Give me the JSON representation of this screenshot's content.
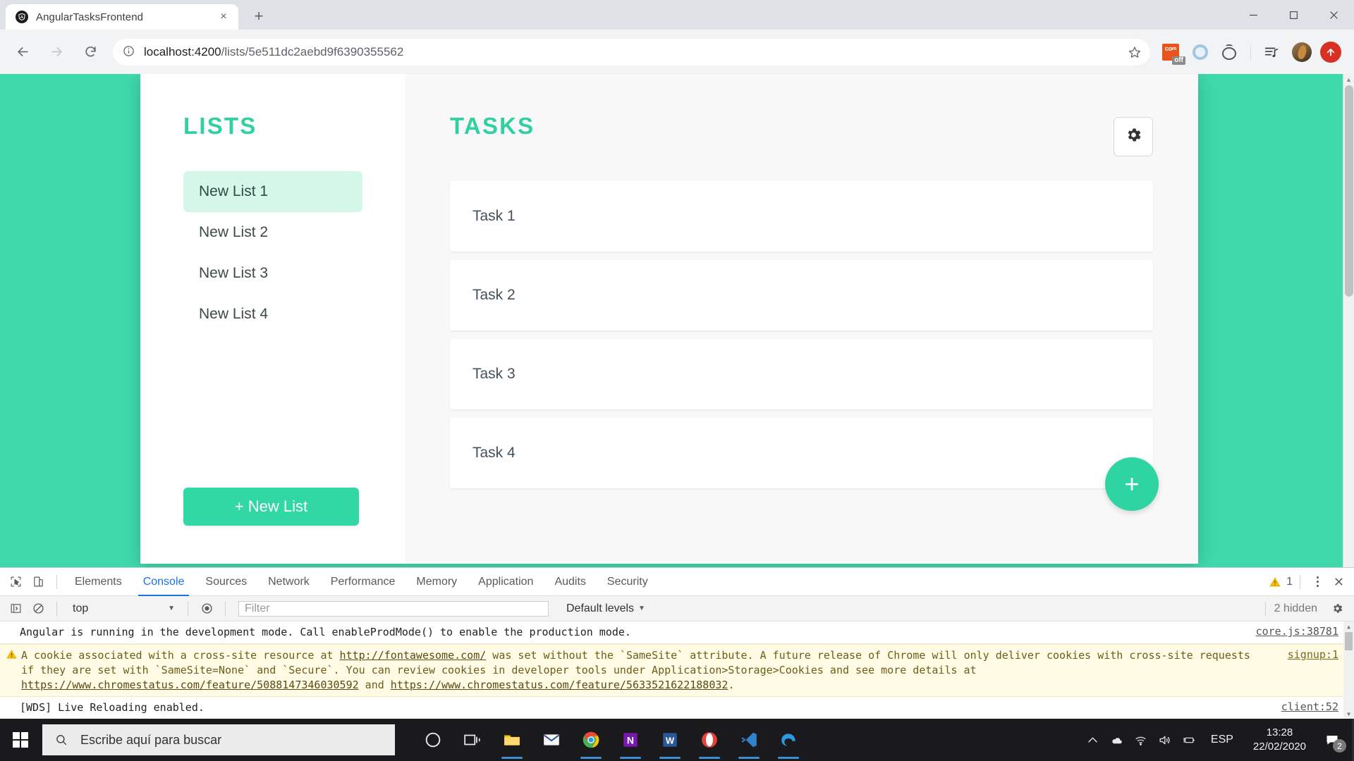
{
  "browser": {
    "tab": {
      "title": "AngularTasksFrontend",
      "favicon": "angular-icon",
      "close_label": "×"
    },
    "new_tab_label": "+",
    "window_controls": {
      "minimize": "minimize-icon",
      "maximize": "maximize-icon",
      "close": "close-icon"
    },
    "nav": {
      "back": "back-arrow-icon",
      "forward": "forward-arrow-icon",
      "reload": "reload-icon"
    },
    "omnibox": {
      "info_icon": "info-circle-icon",
      "host": "localhost:4200",
      "path": "/lists/5e511dc2aebd9f6390355562",
      "star_icon": "star-icon"
    },
    "extensions": [
      {
        "name": "com-extension",
        "label": "co",
        "sup": "m",
        "badge": "off"
      },
      {
        "name": "blue-ring-extension"
      },
      {
        "name": "tomato-timer-extension"
      },
      {
        "name": "music-queue-icon"
      }
    ],
    "profile": {
      "name": "avatar"
    },
    "update_button": {
      "name": "update-available-button",
      "icon": "arrow-up-icon"
    }
  },
  "app": {
    "lists_panel": {
      "title": "LISTS",
      "items": [
        {
          "label": "New List 1",
          "active": true
        },
        {
          "label": "New List 2",
          "active": false
        },
        {
          "label": "New List 3",
          "active": false
        },
        {
          "label": "New List 4",
          "active": false
        }
      ],
      "new_list_button": "+ New List"
    },
    "tasks_panel": {
      "title": "TASKS",
      "settings_icon": "gear-icon",
      "tasks": [
        {
          "label": "Task 1"
        },
        {
          "label": "Task 2"
        },
        {
          "label": "Task 3"
        },
        {
          "label": "Task 4"
        }
      ],
      "add_task_fab": "+"
    },
    "colors": {
      "accent": "#31d8a4",
      "background": "#3ed9ab",
      "active_item": "#d4f7ea",
      "panel_bg": "#f8f8f8"
    }
  },
  "devtools": {
    "inspect_icon": "inspect-element-icon",
    "device_icon": "device-toolbar-icon",
    "tabs": [
      {
        "label": "Elements",
        "active": false
      },
      {
        "label": "Console",
        "active": true
      },
      {
        "label": "Sources",
        "active": false
      },
      {
        "label": "Network",
        "active": false
      },
      {
        "label": "Performance",
        "active": false
      },
      {
        "label": "Memory",
        "active": false
      },
      {
        "label": "Application",
        "active": false
      },
      {
        "label": "Audits",
        "active": false
      },
      {
        "label": "Security",
        "active": false
      }
    ],
    "warning_count": "1",
    "more_icon": "kebab-menu-icon",
    "close_icon": "close-icon",
    "console_toolbar": {
      "sidebar_icon": "console-sidebar-icon",
      "clear_icon": "clear-console-icon",
      "context": "top",
      "eye_icon": "live-expression-icon",
      "filter_placeholder": "Filter",
      "levels": "Default levels",
      "caret": "▼",
      "hidden": "2 hidden",
      "settings_icon": "gear-icon"
    },
    "messages": [
      {
        "type": "log",
        "text": "Angular is running in the development mode. Call enableProdMode() to enable the production mode.",
        "source": "core.js:38781"
      },
      {
        "type": "warning",
        "line1_a": "A cookie associated with a cross-site resource at ",
        "link1": "http://fontawesome.com/",
        "line1_b": " was set without the `SameSite` attribute. A future release of Chrome will only deliver cookies with",
        "line2_a": "cross-site requests if they are set with `SameSite=None` and `Secure`. You can review cookies in developer tools under Application>Storage>Cookies and see more details at ",
        "link2": "https://www.chromestatus.com/feature/5088147346030592",
        "line2_b": " and ",
        "link3": "https://www.chromestatus.com/feature/5633521622188032",
        "line2_c": ".",
        "source": "signup:1"
      },
      {
        "type": "log",
        "text": "[WDS] Live Reloading enabled.",
        "source": "client:52"
      }
    ]
  },
  "taskbar": {
    "start_label": "start-button",
    "search_placeholder": "Escribe aquí para buscar",
    "apps": [
      {
        "name": "cortana-icon",
        "running": false
      },
      {
        "name": "task-view-icon",
        "running": false
      },
      {
        "name": "file-explorer-icon",
        "running": true
      },
      {
        "name": "mail-icon",
        "running": false
      },
      {
        "name": "chrome-icon",
        "running": true
      },
      {
        "name": "onenote-icon",
        "running": true
      },
      {
        "name": "word-icon",
        "running": true
      },
      {
        "name": "opera-icon",
        "running": true
      },
      {
        "name": "vscode-icon",
        "running": true
      },
      {
        "name": "edge-icon",
        "running": true
      }
    ],
    "tray": {
      "chevron": "show-hidden-icons",
      "onedrive": "onedrive-icon",
      "wifi": "wifi-icon",
      "volume": "volume-icon",
      "battery": "battery-charging-icon",
      "language": "ESP",
      "time": "13:28",
      "date": "22/02/2020",
      "notifications_count": "2"
    }
  }
}
